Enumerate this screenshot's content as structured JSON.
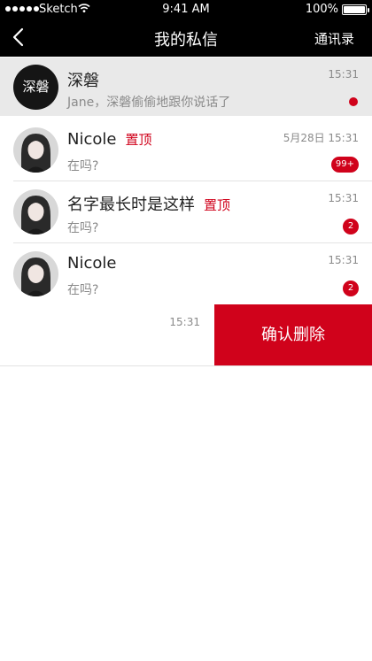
{
  "status_bar": {
    "carrier": "Sketch",
    "time": "9:41 AM",
    "battery": "100%"
  },
  "nav": {
    "title": "我的私信",
    "right_action": "通讯录",
    "back_icon": "chevron-left-icon"
  },
  "system_row": {
    "avatar_text": "深磐",
    "name": "深磐",
    "preview": "Jane，深磐偷偷地跟你说话了",
    "time": "15:31"
  },
  "conversations": [
    {
      "name": "Nicole",
      "pin": "置顶",
      "preview": "在吗?",
      "time": "5月28日 15:31",
      "badge": "99+"
    },
    {
      "name": "名字最长时是这样",
      "pin": "置顶",
      "preview": "在吗?",
      "time": "15:31",
      "badge": "2"
    },
    {
      "name": "Nicole",
      "pin": "",
      "preview": "在吗?",
      "time": "15:31",
      "badge": "2"
    }
  ],
  "swiped_row": {
    "time": "15:31",
    "delete_label": "确认删除"
  },
  "colors": {
    "accent": "#d0021b",
    "nav_bg": "#000000",
    "highlight_row": "#e9e9e9"
  }
}
